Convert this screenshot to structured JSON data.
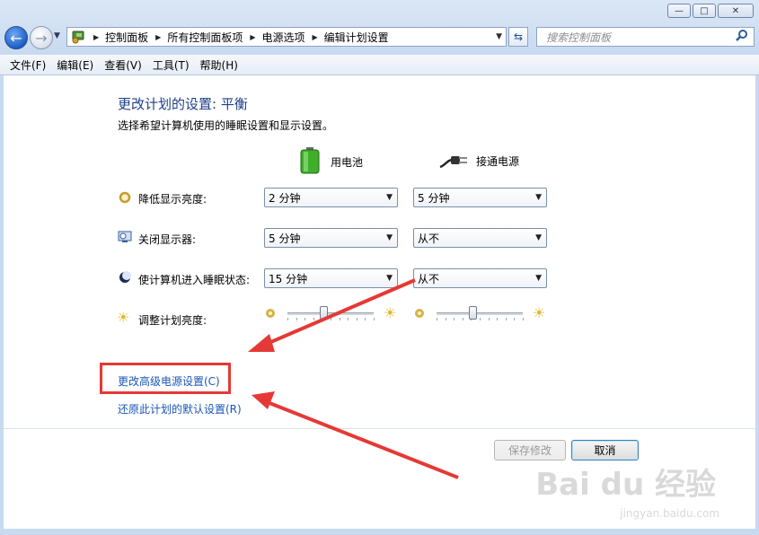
{
  "window": {
    "controls": {
      "minimize": "—",
      "maximize": "□",
      "close": "✕"
    }
  },
  "nav": {
    "back_icon": "back-arrow-icon",
    "forward_icon": "forward-arrow-icon",
    "breadcrumbs": [
      "控制面板",
      "所有控制面板项",
      "电源选项",
      "编辑计划设置"
    ],
    "search_placeholder": "搜索控制面板"
  },
  "menu": [
    "文件(F)",
    "编辑(E)",
    "查看(V)",
    "工具(T)",
    "帮助(H)"
  ],
  "page": {
    "title": "更改计划的设置: 平衡",
    "subtitle": "选择希望计算机使用的睡眠设置和显示设置。",
    "columns": {
      "battery": "用电池",
      "plugged": "接通电源"
    },
    "settings": [
      {
        "label": "降低显示亮度:",
        "icon": "dim-display-icon",
        "battery": "2 分钟",
        "plugged": "5 分钟"
      },
      {
        "label": "关闭显示器:",
        "icon": "display-off-icon",
        "battery": "5 分钟",
        "plugged": "从不"
      },
      {
        "label": "使计算机进入睡眠状态:",
        "icon": "sleep-icon",
        "battery": "15 分钟",
        "plugged": "从不"
      }
    ],
    "brightness": {
      "label": "调整计划亮度:",
      "battery_level": 0.42,
      "plugged_level": 0.42
    },
    "links": {
      "advanced": "更改高级电源设置(C)",
      "restore": "还原此计划的默认设置(R)"
    },
    "buttons": {
      "save": "保存修改",
      "cancel": "取消"
    }
  },
  "watermark": {
    "brand": "Bai du 经验",
    "url": "jingyan.baidu.com"
  },
  "colors": {
    "title": "#1e3f88",
    "link": "#1a56b8",
    "annotation": "#e53935"
  }
}
